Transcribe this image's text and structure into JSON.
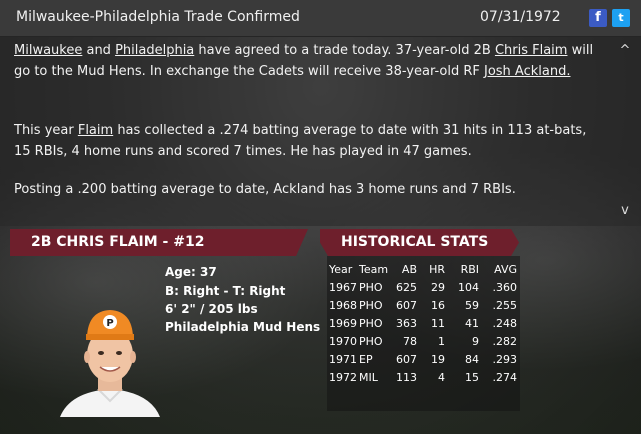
{
  "header": {
    "title": "Milwaukee-Philadelphia Trade Confirmed",
    "date": "07/31/1972",
    "facebook_glyph": "f",
    "twitter_glyph": "t"
  },
  "story": {
    "p1": [
      {
        "text": "Milwaukee",
        "link": true
      },
      {
        "text": " and ",
        "link": false
      },
      {
        "text": "Philadelphia",
        "link": true
      },
      {
        "text": " have agreed to a trade today. 37-year-old 2B ",
        "link": false
      },
      {
        "text": "Chris Flaim",
        "link": true
      },
      {
        "text": " will go to the Mud Hens. In exchange the Cadets will receive 38-year-old RF ",
        "link": false
      },
      {
        "text": "Josh Ackland.",
        "link": true
      }
    ],
    "p2": [
      {
        "text": "This year ",
        "link": false
      },
      {
        "text": "Flaim",
        "link": true
      },
      {
        "text": " has collected a .274 batting average to date with 31 hits in 113 at-bats, 15 RBIs, 4 home runs and scored 7 times. He has played in 47 games.",
        "link": false
      }
    ],
    "p3": "Posting a .200 batting average to date, Ackland has 3 home runs and 7 RBIs.",
    "scroll_up_glyph": "^",
    "scroll_down_glyph": "v"
  },
  "player": {
    "header": "2B CHRIS FLAIM - #12",
    "age": "Age: 37",
    "bats_throws": "B: Right - T: Right",
    "size": "6' 2\" / 205 lbs",
    "team": "Philadelphia Mud Hens",
    "cap_letter": "P"
  },
  "stats": {
    "header": "HISTORICAL STATS",
    "columns": [
      "Year",
      "Team",
      "AB",
      "HR",
      "RBI",
      "AVG"
    ],
    "rows": [
      [
        "1967",
        "PHO",
        "625",
        "29",
        "104",
        ".360"
      ],
      [
        "1968",
        "PHO",
        "607",
        "16",
        "59",
        ".255"
      ],
      [
        "1969",
        "PHO",
        "363",
        "11",
        "41",
        ".248"
      ],
      [
        "1970",
        "PHO",
        "78",
        "1",
        "9",
        ".282"
      ],
      [
        "1971",
        "EP",
        "607",
        "19",
        "84",
        ".293"
      ],
      [
        "1972",
        "MIL",
        "113",
        "4",
        "15",
        ".274"
      ]
    ]
  },
  "colors": {
    "header_bar": "#6e1f2c",
    "facebook": "#3b5bc4",
    "twitter": "#1da1f2",
    "cap": "#f08a24"
  }
}
